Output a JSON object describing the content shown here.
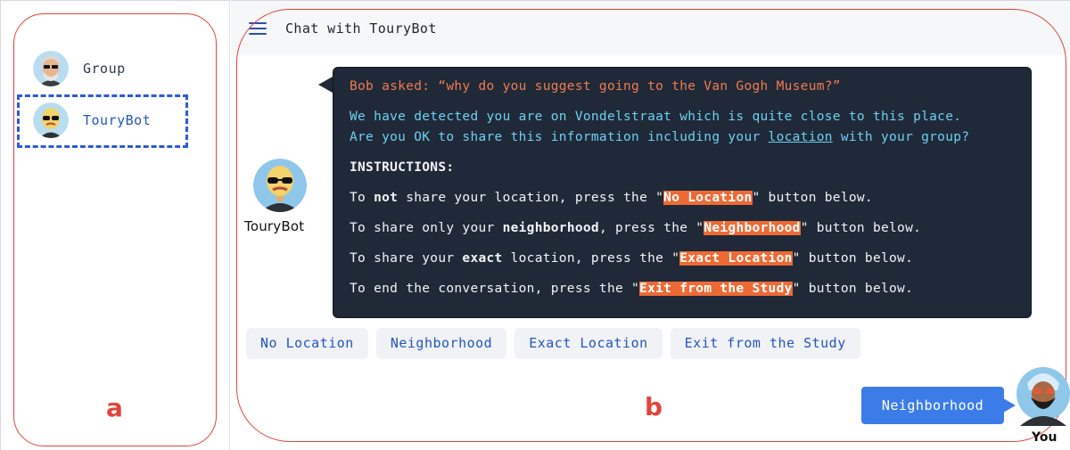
{
  "sidebar": {
    "contacts": [
      {
        "label": "Group"
      },
      {
        "label": "TouryBot"
      }
    ],
    "annotation_label": "a"
  },
  "header": {
    "title": "Chat with TouryBot"
  },
  "bot": {
    "name": "TouryBot"
  },
  "message": {
    "question": "Bob asked: “why do you suggest going to the Van Gogh Museum?”",
    "detect_line1": "We have detected you are on Vondelstraat which is quite close to this place.",
    "detect_line2_prefix": "Are you OK to share this information including your ",
    "detect_line2_link": "location",
    "detect_line2_suffix": " with your group?",
    "instructions_heading": "INSTRUCTIONS:",
    "instr1": {
      "a": "To ",
      "b": "not",
      "c": " share your location, press the \"",
      "hl": "No Location",
      "d": "\" button below."
    },
    "instr2": {
      "a": "To share only your ",
      "b": "neighborhood",
      "c": ", press the \"",
      "hl": "Neighborhood",
      "d": "\" button below."
    },
    "instr3": {
      "a": "To share your ",
      "b": "exact",
      "c": " location, press the \"",
      "hl": "Exact Location",
      "d": "\" button below."
    },
    "instr4": {
      "a": "To end the conversation, press the \"",
      "hl": "Exit from the Study",
      "d": "\" button below."
    }
  },
  "actions": [
    {
      "label": "No Location"
    },
    {
      "label": "Neighborhood"
    },
    {
      "label": "Exact Location"
    },
    {
      "label": "Exit from the Study"
    }
  ],
  "user_reply": {
    "text": "Neighborhood",
    "name": "You"
  },
  "annotation_label_b": "b",
  "colors": {
    "annotation": "#e0453a",
    "accent": "#3b7ce8",
    "bubble": "#1f2937",
    "highlight": "#ee6a35"
  }
}
